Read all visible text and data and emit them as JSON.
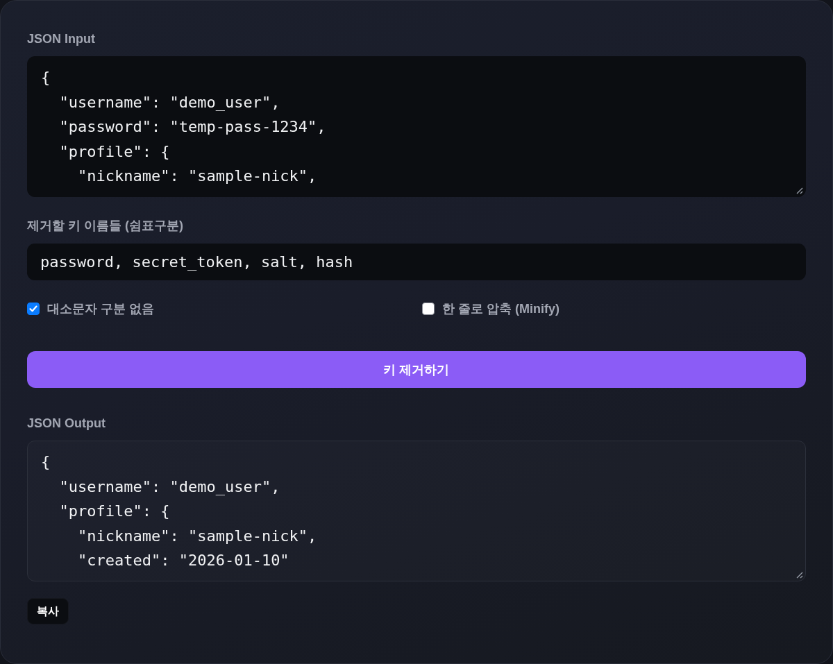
{
  "json_input": {
    "label": "JSON Input",
    "value": "{\n  \"username\": \"demo_user\",\n  \"password\": \"temp-pass-1234\",\n  \"profile\": {\n    \"nickname\": \"sample-nick\","
  },
  "keys_to_remove": {
    "label": "제거할 키 이름들 (쉼표구분)",
    "value": "password, secret_token, salt, hash"
  },
  "options": [
    {
      "label": "대소문자 구분 없음",
      "checked": true
    },
    {
      "label": "한 줄로 압축 (Minify)",
      "checked": false
    }
  ],
  "remove_button": {
    "label": "키 제거하기"
  },
  "json_output": {
    "label": "JSON Output",
    "value": "{\n  \"username\": \"demo_user\",\n  \"profile\": {\n    \"nickname\": \"sample-nick\",\n    \"created\": \"2026-01-10\""
  },
  "copy_button": {
    "label": "복사"
  }
}
